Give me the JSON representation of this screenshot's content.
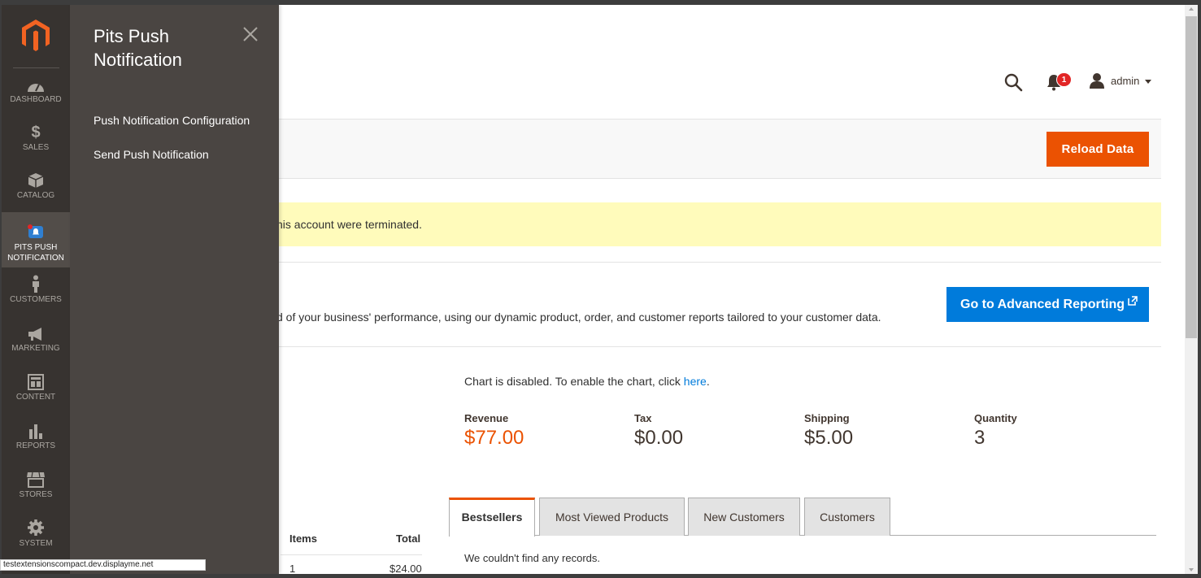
{
  "header": {
    "admin_label": "admin",
    "notification_count": "1"
  },
  "actions": {
    "reload_label": "Reload Data"
  },
  "notice": {
    "text": "his account were terminated."
  },
  "advanced_reporting": {
    "description": "d of your business' performance, using our dynamic product, order, and customer reports tailored to your customer data.",
    "button_label": "Go to Advanced Reporting"
  },
  "chart": {
    "note_prefix": "Chart is disabled. To enable the chart, click ",
    "note_link": "here",
    "note_suffix": "."
  },
  "stats": [
    {
      "label": "Revenue",
      "value": "$77.00"
    },
    {
      "label": "Tax",
      "value": "$0.00"
    },
    {
      "label": "Shipping",
      "value": "$5.00"
    },
    {
      "label": "Quantity",
      "value": "3"
    }
  ],
  "orders_table": {
    "headers": [
      "Items",
      "Total"
    ],
    "rows": [
      [
        "1",
        "$24.00"
      ]
    ]
  },
  "tabs": [
    {
      "label": "Bestsellers",
      "active": true
    },
    {
      "label": "Most Viewed Products",
      "active": false
    },
    {
      "label": "New Customers",
      "active": false
    },
    {
      "label": "Customers",
      "active": false
    }
  ],
  "tab_content": {
    "empty_text": "We couldn't find any records."
  },
  "nav": {
    "items": [
      {
        "label": "DASHBOARD",
        "icon": "dashboard-icon"
      },
      {
        "label": "SALES",
        "icon": "dollar-icon"
      },
      {
        "label": "CATALOG",
        "icon": "cube-icon"
      },
      {
        "label_line1": "PITS PUSH",
        "label_line2": "NOTIFICATION",
        "icon": "push-notification-icon",
        "active": true
      },
      {
        "label": "CUSTOMERS",
        "icon": "person-icon"
      },
      {
        "label": "MARKETING",
        "icon": "megaphone-icon"
      },
      {
        "label": "CONTENT",
        "icon": "layout-icon"
      },
      {
        "label": "REPORTS",
        "icon": "bar-chart-icon"
      },
      {
        "label": "STORES",
        "icon": "store-icon"
      },
      {
        "label": "SYSTEM",
        "icon": "gear-icon"
      }
    ]
  },
  "flyout": {
    "title": "Pits Push Notification",
    "links": [
      "Push Notification Configuration",
      "Send Push Notification"
    ]
  },
  "status_bar": {
    "url": "testextensionscompact.dev.displayme.net"
  },
  "colors": {
    "accent_orange": "#eb5202",
    "link_blue": "#007bdb",
    "nav_bg": "#373330",
    "flyout_bg": "#4a4542",
    "notice_bg": "#fffbbb"
  }
}
